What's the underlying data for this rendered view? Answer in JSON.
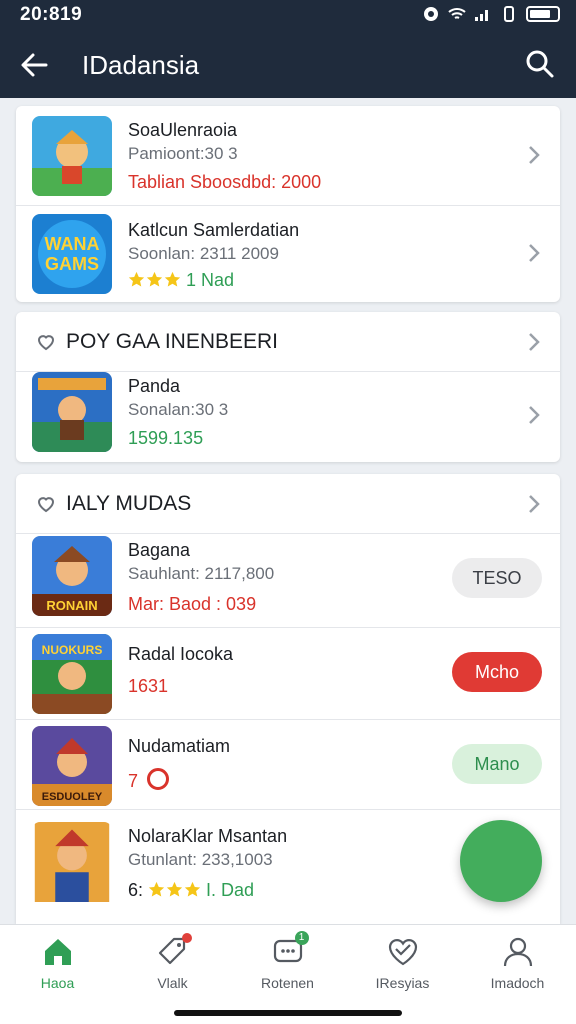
{
  "status": {
    "time": "20:819"
  },
  "header": {
    "title": "IDadansia"
  },
  "featured": [
    {
      "name": "SoaUlenraoia",
      "sub": "Pamioont:30 3",
      "meta": "Tablian Sboosdbd: 2000",
      "thumb": "hero-game-thumbnail"
    },
    {
      "name": "Katlcun Samlerdatian",
      "sub": "Soonlan: 2311 2009",
      "meta": "1 Nad",
      "rating": 3,
      "thumb_label_top": "WANA",
      "thumb_label_bottom": "GAMS"
    }
  ],
  "section1": {
    "title": "POY GAA INENBEERI",
    "items": [
      {
        "name": "Panda",
        "sub": "Sonalan:30 3",
        "meta": "1599.135"
      }
    ]
  },
  "section2": {
    "title": "IALY MUDAS",
    "items": [
      {
        "name": "Bagana",
        "sub": "Sauhlant: 2117,800",
        "meta": "Mar: Baod : 039",
        "action": "TESO",
        "thumb_label": "RONAIN"
      },
      {
        "name": "Radal Iocoka",
        "meta": "1631",
        "action": "Mcho",
        "thumb_label": "NUOKURS"
      },
      {
        "name": "Nudamatiam",
        "meta": "7",
        "action": "Mano",
        "thumb_label": "ESDUOLEY"
      },
      {
        "name": "NolaraKlar Msantan",
        "sub": "Gtunlant: 233,1003",
        "meta_prefix": "6:",
        "meta": "I. Dad",
        "rating": 3
      }
    ]
  },
  "bottom_nav": [
    {
      "label": "Haoa",
      "icon": "home-icon",
      "active": true
    },
    {
      "label": "Vlalk",
      "icon": "tag-icon"
    },
    {
      "label": "Rotenen",
      "icon": "chat-icon",
      "badge": "1"
    },
    {
      "label": "IResyias",
      "icon": "heart-icon"
    },
    {
      "label": "Imadoch",
      "icon": "profile-icon"
    }
  ],
  "colors": {
    "header_bg": "#1f2b3c",
    "accent_green": "#43ad5c",
    "price_red": "#d9332b"
  }
}
